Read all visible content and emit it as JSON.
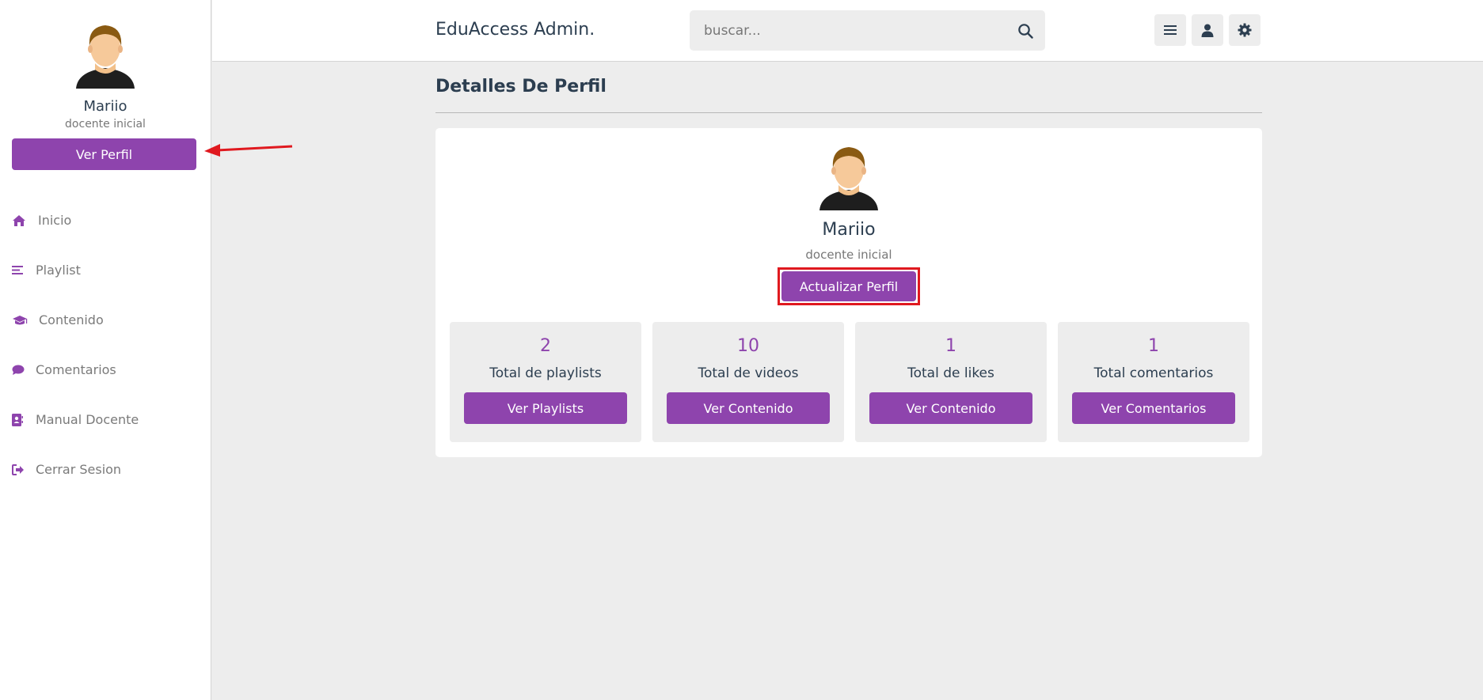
{
  "app": {
    "title": "EduAccess Admin."
  },
  "search": {
    "placeholder": "buscar..."
  },
  "sidebar": {
    "name": "Mariio",
    "role": "docente inicial",
    "profile_button": "Ver Perfil",
    "items": [
      {
        "label": "Inicio",
        "icon": "home-icon"
      },
      {
        "label": "Playlist",
        "icon": "list-icon"
      },
      {
        "label": "Contenido",
        "icon": "graduation-cap-icon"
      },
      {
        "label": "Comentarios",
        "icon": "comment-icon"
      },
      {
        "label": "Manual Docente",
        "icon": "contact-book-icon"
      },
      {
        "label": "Cerrar Sesion",
        "icon": "sign-out-icon"
      }
    ]
  },
  "header": {
    "buttons": [
      {
        "icon": "menu-icon"
      },
      {
        "icon": "user-icon"
      },
      {
        "icon": "gear-icon"
      }
    ]
  },
  "main": {
    "title": "Detalles De Perfil",
    "profile": {
      "name": "Mariio",
      "role": "docente inicial",
      "update_button": "Actualizar Perfil"
    },
    "stats": [
      {
        "count": "2",
        "label": "Total de playlists",
        "button": "Ver Playlists"
      },
      {
        "count": "10",
        "label": "Total de videos",
        "button": "Ver Contenido"
      },
      {
        "count": "1",
        "label": "Total de likes",
        "button": "Ver Contenido"
      },
      {
        "count": "1",
        "label": "Total comentarios",
        "button": "Ver Comentarios"
      }
    ]
  },
  "colors": {
    "accent": "#8e44ad",
    "highlight": "#e0191f",
    "background": "#ededed",
    "text": "#2c3e50"
  }
}
